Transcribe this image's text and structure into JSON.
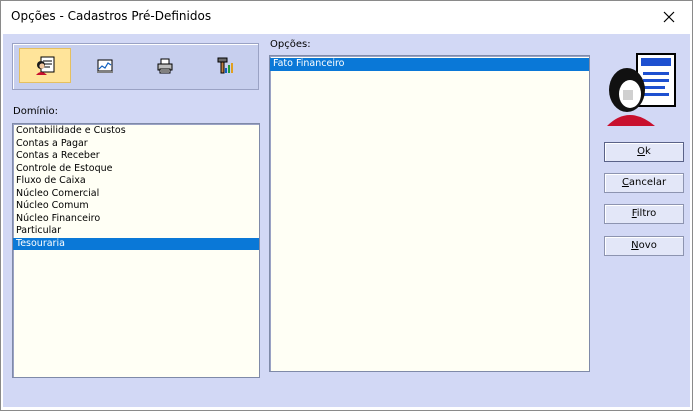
{
  "window": {
    "title": "Opções - Cadastros Pré-Definidos"
  },
  "toolbar": {
    "buttons": [
      {
        "icon": "user-card-icon",
        "active": true
      },
      {
        "icon": "chart-icon",
        "active": false
      },
      {
        "icon": "printer-icon",
        "active": false
      },
      {
        "icon": "tools-icon",
        "active": false
      }
    ]
  },
  "dominio": {
    "label": "Domínio:",
    "items": [
      "Contabilidade e Custos",
      "Contas a Pagar",
      "Contas a Receber",
      "Controle de Estoque",
      "Fluxo de Caixa",
      "Núcleo Comercial",
      "Núcleo Comum",
      "Núcleo Financeiro",
      "Particular",
      "Tesouraria"
    ],
    "selected": "Tesouraria"
  },
  "opcoes": {
    "label": "Opções:",
    "items": [
      "Fato Financeiro"
    ],
    "selected": "Fato Financeiro"
  },
  "buttons": {
    "ok": {
      "first": "O",
      "rest": "k"
    },
    "cancelar": {
      "first": "C",
      "rest": "ancelar"
    },
    "filtro": {
      "first": "F",
      "rest": "iltro"
    },
    "novo": {
      "first": "N",
      "rest": "ovo"
    }
  },
  "colors": {
    "selection": "#0a78d7",
    "client_bg": "#d2d8f5",
    "active_tool": "#ffe49a"
  }
}
